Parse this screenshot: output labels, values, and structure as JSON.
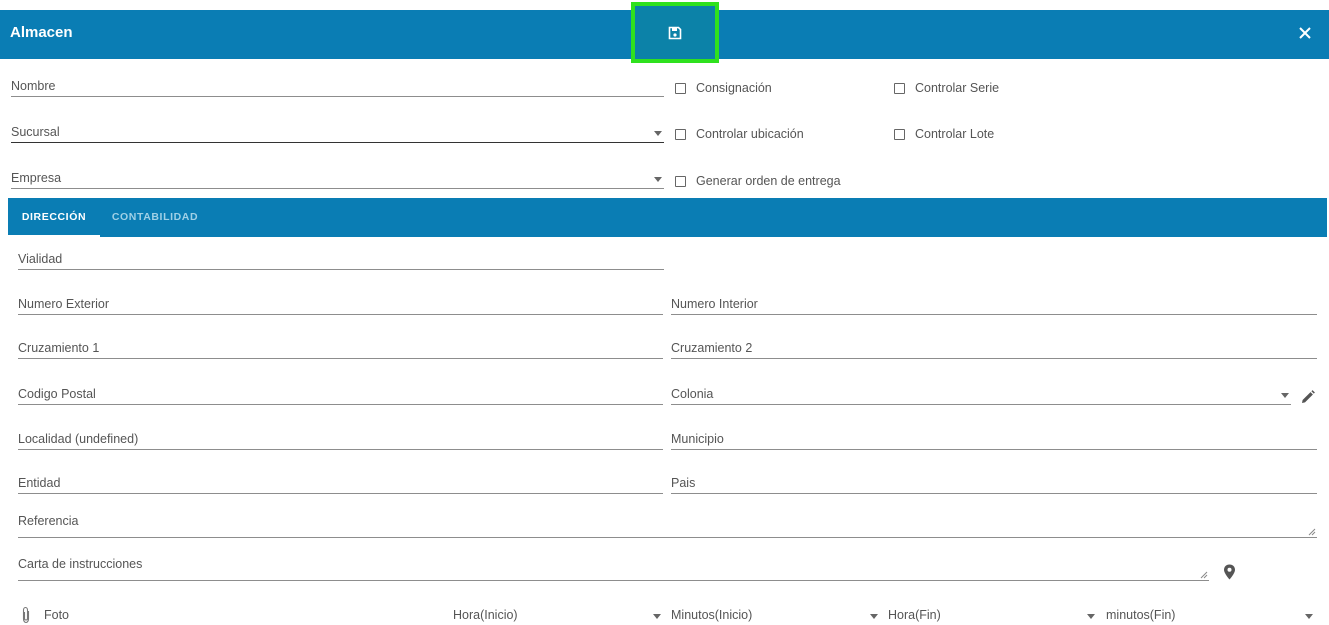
{
  "header": {
    "title": "Almacen"
  },
  "form": {
    "nombre_label": "Nombre",
    "sucursal_label": "Sucursal",
    "empresa_label": "Empresa",
    "checkboxes": {
      "consignacion": "Consignación",
      "controlar_serie": "Controlar Serie",
      "controlar_ubicacion": "Controlar ubicación",
      "controlar_lote": "Controlar Lote",
      "generar_orden": "Generar orden de entrega"
    }
  },
  "tabs": {
    "direccion": "DIRECCIÓN",
    "contabilidad": "CONTABILIDAD"
  },
  "address": {
    "vialidad": "Vialidad",
    "numero_exterior": "Numero Exterior",
    "numero_interior": "Numero Interior",
    "cruzamiento1": "Cruzamiento 1",
    "cruzamiento2": "Cruzamiento 2",
    "codigo_postal": "Codigo Postal",
    "colonia": "Colonia",
    "localidad": "Localidad (undefined)",
    "municipio": "Municipio",
    "entidad": "Entidad",
    "pais": "Pais",
    "referencia": "Referencia",
    "carta_instrucciones": "Carta de instrucciones"
  },
  "bottom": {
    "foto": "Foto",
    "hora_inicio": "Hora(Inicio)",
    "minutos_inicio": "Minutos(Inicio)",
    "hora_fin": "Hora(Fin)",
    "minutos_fin": "minutos(Fin)"
  },
  "icons": {
    "save": "floppy-disk-icon",
    "close": "close-icon",
    "edit": "pencil-icon",
    "location": "map-pin-icon",
    "attach": "paperclip-icon"
  },
  "colors": {
    "primary": "#0a7db4",
    "highlight": "#2fe11e"
  }
}
